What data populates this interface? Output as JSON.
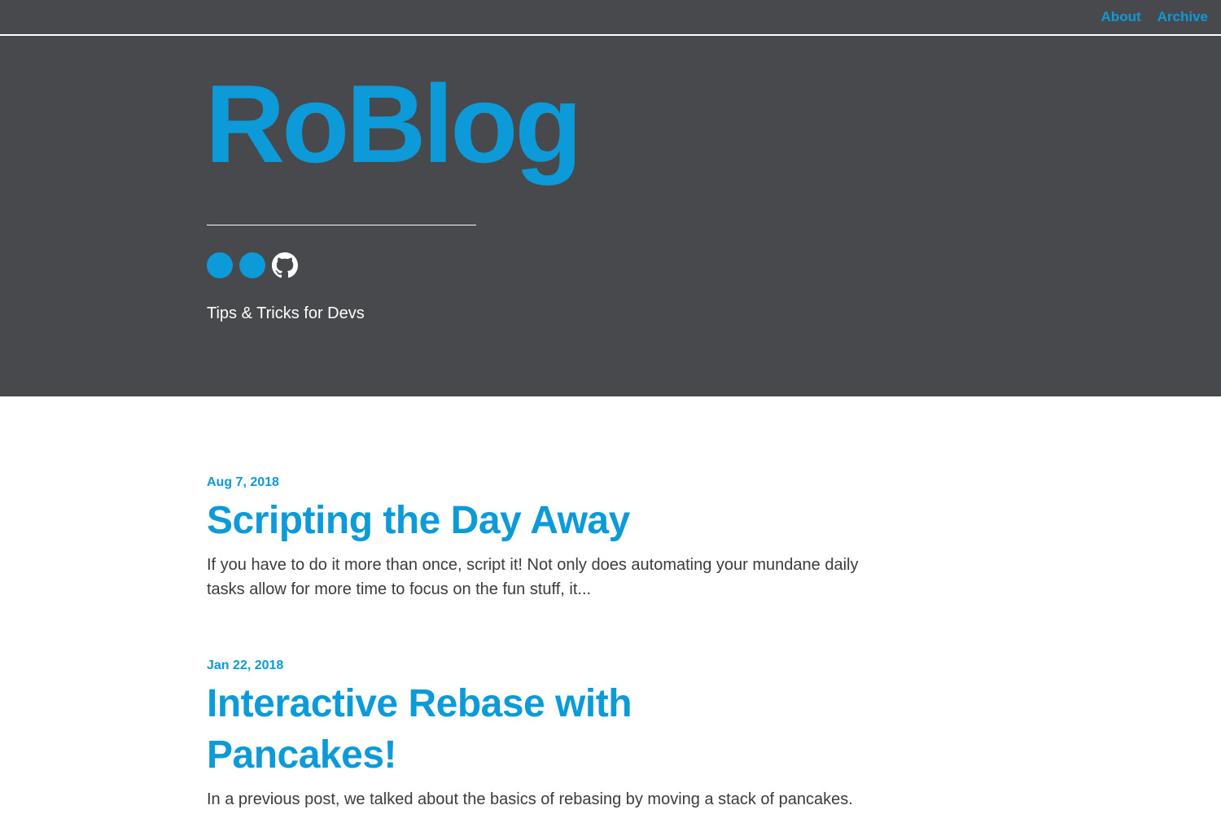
{
  "nav": {
    "about_label": "About",
    "archive_label": "Archive"
  },
  "hero": {
    "title": "RoBlog",
    "tagline": "Tips & Tricks for Devs",
    "socials": [
      "social-icon",
      "social-icon",
      "github-icon"
    ]
  },
  "posts": [
    {
      "date": "Aug 7, 2018",
      "title": "Scripting the Day Away",
      "excerpt": "If you have to do it more than once, script it! Not only does automating your mundane daily tasks allow for more time to focus on the fun stuff, it..."
    },
    {
      "date": "Jan 22, 2018",
      "title": "Interactive Rebase with Pancakes!",
      "excerpt": "In a previous post, we talked about the basics of rebasing by moving a stack of pancakes."
    }
  ],
  "colors": {
    "accent": "#0c9ad8",
    "header_bg": "#48494d",
    "body_text": "#3b3b3f"
  }
}
